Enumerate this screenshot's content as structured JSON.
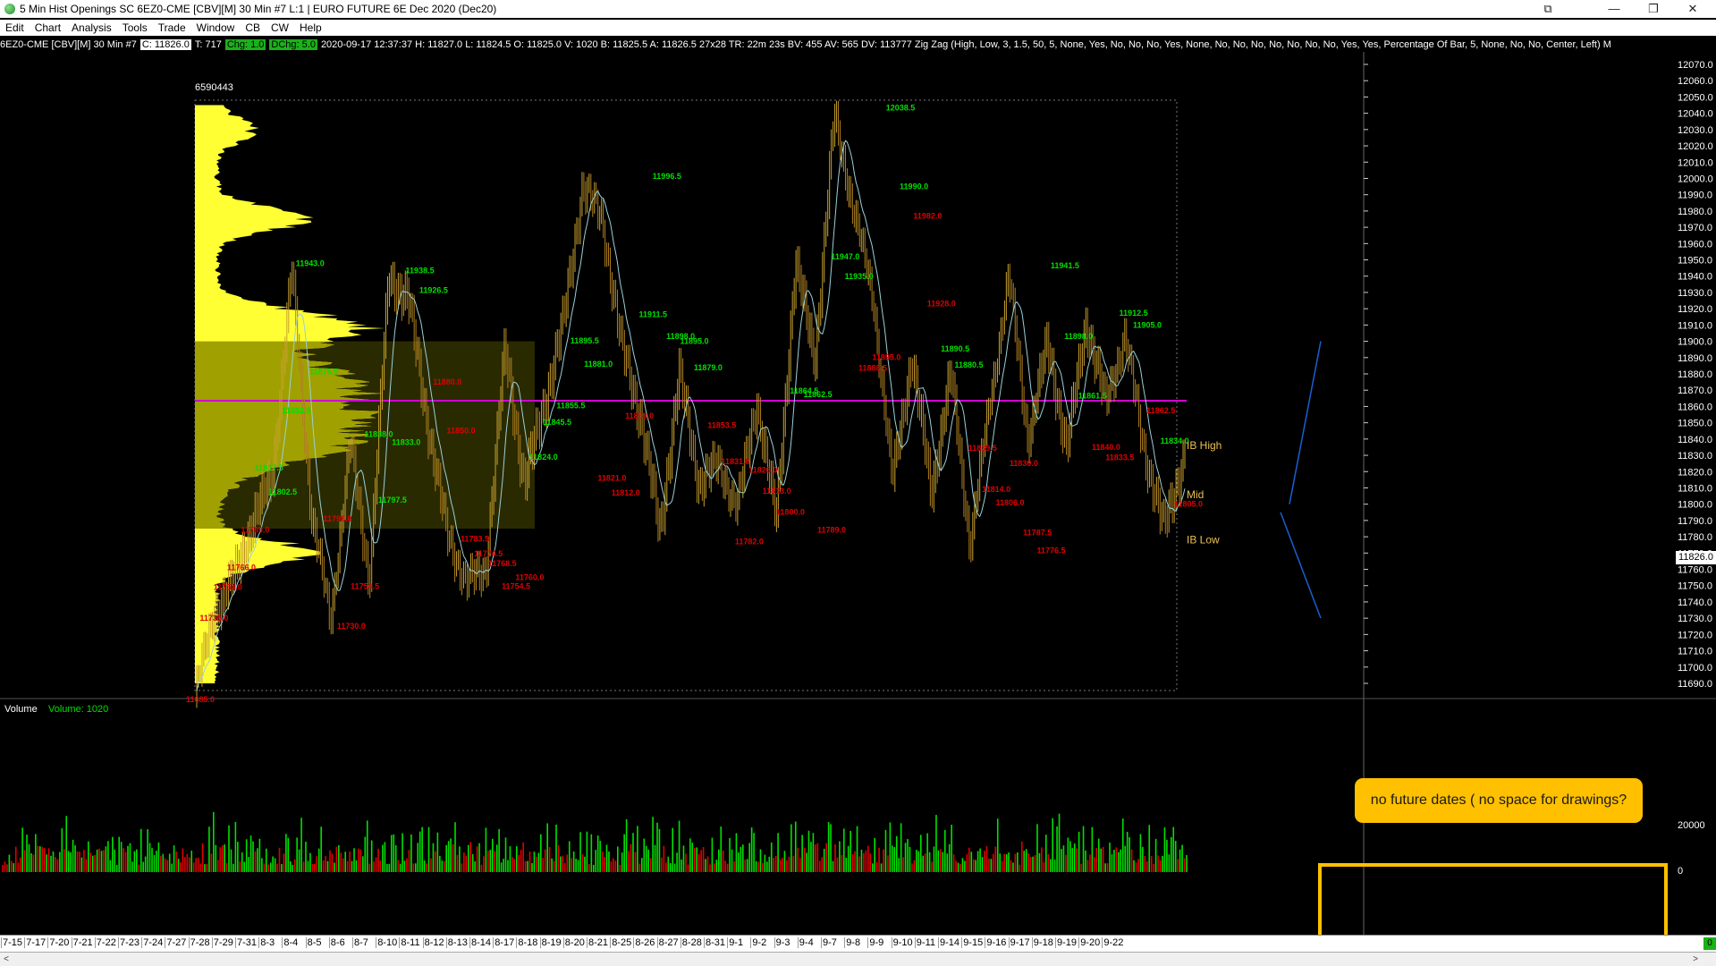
{
  "window": {
    "title": "5 Min Hist Openings  SC 6EZ0-CME [CBV][M]  30 Min   #7  L:1 | EURO FUTURE 6E Dec 2020 (Dec20)",
    "minimize": "—",
    "maximize": "❐",
    "close": "✕",
    "restore_icon": "restore-icon"
  },
  "menu": [
    "Edit",
    "Chart",
    "Analysis",
    "Tools",
    "Trade",
    "Window",
    "CB",
    "CW",
    "Help"
  ],
  "infobar": {
    "symbol": "6EZ0-CME [CBV][M]  30 Min   #7",
    "close": "C: 11826.0",
    "trades": "T: 717",
    "chg": "Chg: 1.0",
    "dchg": "DChg: 5.0",
    "rest": "2020-09-17 12:37:37 H: 11827.0 L: 11824.5 O: 11825.0 V: 1020 B: 11825.5 A: 11826.5 27x28 TR: 22m 23s BV: 455 AV: 565 DV: 113777 Zig Zag  (High, Low, 3, 1.5, 50, 5, None, Yes, No, No, No, Yes, None, No, No, No, No, No, No, No, Yes, Yes, Percentage Of Bar, 5, None, No, No, Center, Left)  M"
  },
  "price_axis": {
    "labels": [
      "12070.0",
      "12060.0",
      "12050.0",
      "12040.0",
      "12030.0",
      "12020.0",
      "12010.0",
      "12000.0",
      "11990.0",
      "11980.0",
      "11970.0",
      "11960.0",
      "11950.0",
      "11940.0",
      "11930.0",
      "11920.0",
      "11910.0",
      "11900.0",
      "11890.0",
      "11880.0",
      "11870.0",
      "11860.0",
      "11850.0",
      "11840.0",
      "11830.0",
      "11820.0",
      "11810.0",
      "11800.0",
      "11790.0",
      "11780.0",
      "11770.0",
      "11760.0",
      "11750.0",
      "11740.0",
      "11730.0",
      "11720.0",
      "11710.0",
      "11700.0",
      "11690.0"
    ],
    "current": "11826.0"
  },
  "profile": {
    "volume_label": "6590443",
    "poc": "11863.5",
    "value_area_high": "11900.0",
    "value_area_low": "11785.0"
  },
  "zigzag_labels": [
    {
      "text": "11685.0",
      "type": "low"
    },
    {
      "text": "11735.0",
      "type": "low"
    },
    {
      "text": "11754.0",
      "type": "low"
    },
    {
      "text": "11766.0",
      "type": "low"
    },
    {
      "text": "11789.0",
      "type": "low"
    },
    {
      "text": "11817.5",
      "type": "high"
    },
    {
      "text": "11802.5",
      "type": "high"
    },
    {
      "text": "11852.5",
      "type": "high"
    },
    {
      "text": "11943.0",
      "type": "high"
    },
    {
      "text": "11876.5",
      "type": "high"
    },
    {
      "text": "11796.0",
      "type": "low"
    },
    {
      "text": "11730.0",
      "type": "low"
    },
    {
      "text": "11754.5",
      "type": "low"
    },
    {
      "text": "11838.0",
      "type": "high"
    },
    {
      "text": "11797.5",
      "type": "high"
    },
    {
      "text": "11833.0",
      "type": "high"
    },
    {
      "text": "11938.5",
      "type": "high"
    },
    {
      "text": "11926.5",
      "type": "high"
    },
    {
      "text": "11880.0",
      "type": "low"
    },
    {
      "text": "11850.0",
      "type": "low"
    },
    {
      "text": "11783.5",
      "type": "low"
    },
    {
      "text": "11774.5",
      "type": "low"
    },
    {
      "text": "11768.5",
      "type": "low"
    },
    {
      "text": "11754.5",
      "type": "low"
    },
    {
      "text": "11760.0",
      "type": "low"
    },
    {
      "text": "11824.0",
      "type": "high"
    },
    {
      "text": "11845.5",
      "type": "high"
    },
    {
      "text": "11855.5",
      "type": "high"
    },
    {
      "text": "11895.5",
      "type": "high"
    },
    {
      "text": "11881.0",
      "type": "high"
    },
    {
      "text": "11821.0",
      "type": "low"
    },
    {
      "text": "11812.0",
      "type": "low"
    },
    {
      "text": "11859.0",
      "type": "low"
    },
    {
      "text": "11911.5",
      "type": "high"
    },
    {
      "text": "11996.5",
      "type": "high"
    },
    {
      "text": "11898.0",
      "type": "high"
    },
    {
      "text": "11895.0",
      "type": "high"
    },
    {
      "text": "11879.0",
      "type": "high"
    },
    {
      "text": "11853.5",
      "type": "low"
    },
    {
      "text": "11831.0",
      "type": "low"
    },
    {
      "text": "11782.0",
      "type": "low"
    },
    {
      "text": "11826.0",
      "type": "low"
    },
    {
      "text": "11813.0",
      "type": "low"
    },
    {
      "text": "11800.0",
      "type": "low"
    },
    {
      "text": "11864.5",
      "type": "high"
    },
    {
      "text": "11862.5",
      "type": "high"
    },
    {
      "text": "11789.0",
      "type": "low"
    },
    {
      "text": "11947.0",
      "type": "high"
    },
    {
      "text": "11935.0",
      "type": "high"
    },
    {
      "text": "11888.5",
      "type": "low"
    },
    {
      "text": "11895.0",
      "type": "low"
    },
    {
      "text": "12038.5",
      "type": "high"
    },
    {
      "text": "11990.0",
      "type": "high"
    },
    {
      "text": "11982.0",
      "type": "low"
    },
    {
      "text": "11928.0",
      "type": "low"
    },
    {
      "text": "11890.5",
      "type": "high"
    },
    {
      "text": "11880.5",
      "type": "high"
    },
    {
      "text": "11839.5",
      "type": "low"
    },
    {
      "text": "11814.0",
      "type": "low"
    },
    {
      "text": "11806.0",
      "type": "low"
    },
    {
      "text": "11830.0",
      "type": "low"
    },
    {
      "text": "11787.5",
      "type": "low"
    },
    {
      "text": "11776.5",
      "type": "low"
    },
    {
      "text": "11941.5",
      "type": "high"
    },
    {
      "text": "11898.0",
      "type": "high"
    },
    {
      "text": "11861.5",
      "type": "high"
    },
    {
      "text": "11840.0",
      "type": "low"
    },
    {
      "text": "11833.5",
      "type": "low"
    },
    {
      "text": "11912.5",
      "type": "high"
    },
    {
      "text": "11905.0",
      "type": "high"
    },
    {
      "text": "11862.5",
      "type": "low"
    },
    {
      "text": "11834.0",
      "type": "high"
    },
    {
      "text": "11805.0",
      "type": "low"
    }
  ],
  "ib_labels": {
    "high": "IB High",
    "mid": "Mid",
    "low": "IB Low"
  },
  "volume_pane": {
    "title": "Volume",
    "value_label": "Volume: 1020",
    "axis": [
      "20000",
      "0"
    ]
  },
  "dates": [
    "7-15",
    "7-17",
    "7-20",
    "7-21",
    "7-22",
    "7-23",
    "7-24",
    "7-27",
    "7-28",
    "7-29",
    "7-31",
    "8-3",
    "8-4",
    "8-5",
    "8-6",
    "8-7",
    "8-10",
    "8-11",
    "8-12",
    "8-13",
    "8-14",
    "8-17",
    "8-18",
    "8-19",
    "8-20",
    "8-21",
    "8-25",
    "8-26",
    "8-27",
    "8-28",
    "8-31",
    "9-1",
    "9-2",
    "9-3",
    "9-4",
    "9-7",
    "9-8",
    "9-9",
    "9-10",
    "9-11",
    "9-14",
    "9-15",
    "9-16",
    "9-17",
    "9-18",
    "9-19",
    "9-20",
    "9-22"
  ],
  "annotation": {
    "callout": "no future dates ( no space for drawings?"
  },
  "scroll": {
    "left": "<",
    "right": ">"
  },
  "corner_badge": "0",
  "colors": {
    "up": "#00e000",
    "down": "#e00000",
    "profile": "#ffff33",
    "value_area": "#a0a000",
    "poc": "#d000d0",
    "trendline": "#1a5fd0",
    "callout": "#ffc000",
    "zigzag_line": "#9ad0d8"
  }
}
